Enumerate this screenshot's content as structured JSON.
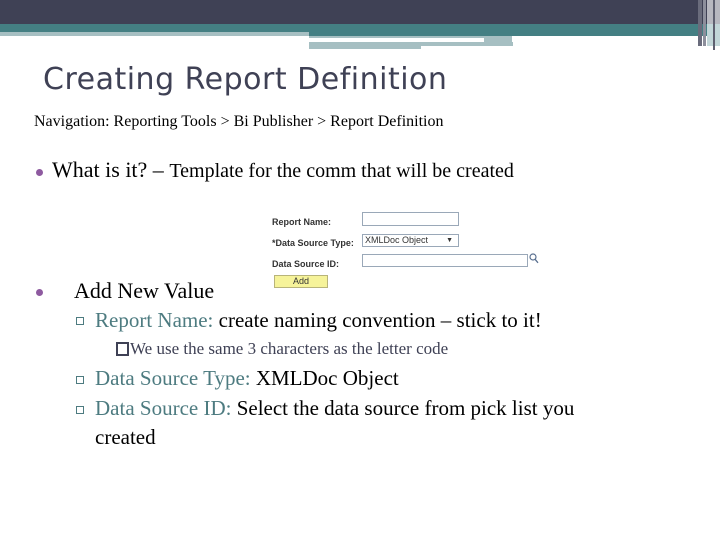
{
  "slide": {
    "title": "Creating Report Definition",
    "navigation": "Navigation: Reporting Tools > Bi Publisher > Report Definition",
    "colors": {
      "header_dark": "#3f4155",
      "header_teal": "#447f83",
      "bullet": "#8e5aa0",
      "sub_label": "#4d7b80"
    }
  },
  "bullets": [
    {
      "lead": "What is it? – ",
      "text": "Template for the comm that will be created"
    },
    {
      "text": "Add New Value",
      "sub": [
        {
          "label": "Report Name:",
          "text": " create naming convention – stick to it!"
        },
        {
          "label": "Data Source Type:",
          "text": " XMLDoc Object"
        },
        {
          "label": "Data Source ID:",
          "text": " Select the data source from pick list you",
          "continuation": "created"
        }
      ],
      "note": "We use the same 3 characters  as the letter code"
    }
  ],
  "form": {
    "report_name_label": "Report Name:",
    "report_name_value": "",
    "data_source_type_label": "*Data Source Type:",
    "data_source_type_value": "XMLDoc Object",
    "data_source_id_label": "Data Source ID:",
    "data_source_id_value": "",
    "lookup_icon": "magnifier-icon",
    "add_button": "Add"
  }
}
